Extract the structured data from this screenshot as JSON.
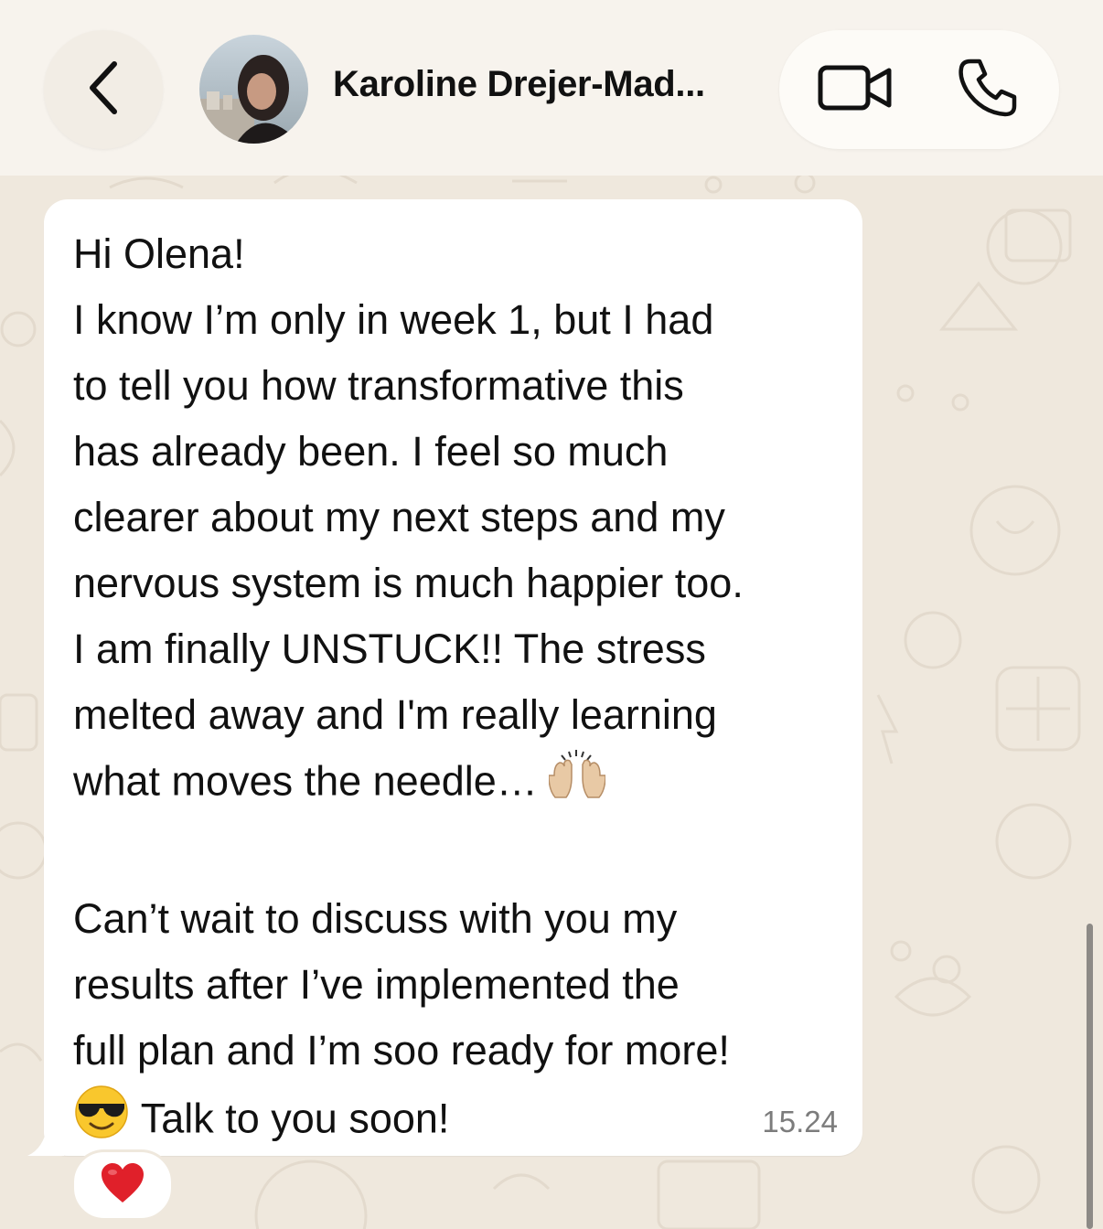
{
  "header": {
    "contact_name": "Karoline Drejer-Mad...",
    "back_icon": "chevron-left-icon",
    "video_icon": "video-camera-icon",
    "phone_icon": "phone-icon"
  },
  "message": {
    "lines": [
      "Hi Olena!",
      "I know I’m only in week 1, but I had",
      "to tell you how transformative this",
      "has already been. I feel so much",
      "clearer about my next steps and my",
      "nervous system is much happier too.",
      "I am finally UNSTUCK!! The stress",
      "melted away and I'm really learning",
      "what moves the needle…",
      "",
      "Can’t wait to discuss with you my",
      "results after I’ve implemented the",
      "full plan and I’m soo ready for more!",
      "Talk to you soon!"
    ],
    "emoji_raising_hands": "raising-hands-icon",
    "emoji_sunglasses": "smiling-face-with-sunglasses-icon",
    "time": "15.24",
    "reaction": "red-heart-icon"
  },
  "colors": {
    "background": "#efe8dd",
    "bubble": "#ffffff",
    "header": "#f7f3ed",
    "timestamp": "#7c7c7c",
    "heart": "#e0202a"
  }
}
